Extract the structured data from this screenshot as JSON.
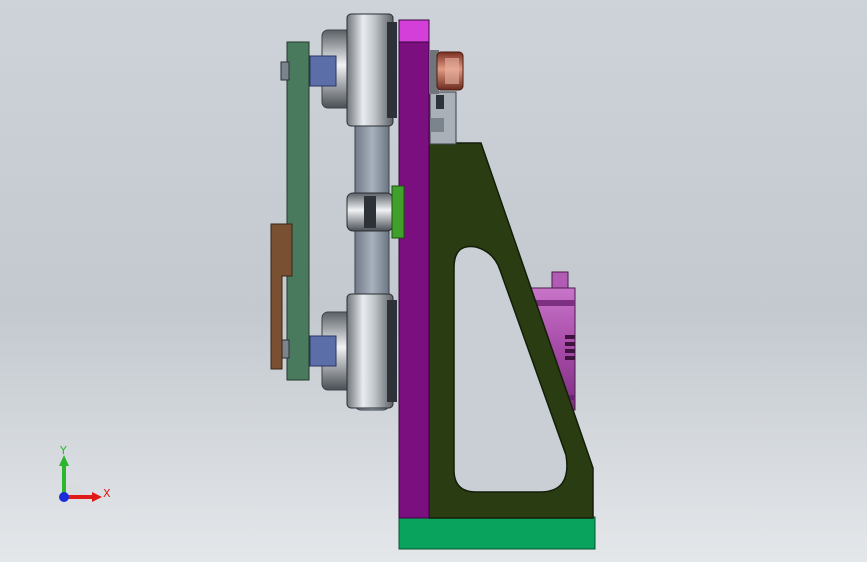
{
  "window": {
    "title": ""
  },
  "triad": {
    "x_label": "X",
    "y_label": "Y",
    "x_color": "#e01919",
    "y_color": "#2db52d",
    "z_color": "#1a2bd8"
  },
  "colors": {
    "background_top": "#cdd3d9",
    "background_bottom": "#e4e7ea",
    "base_plate": "#0aa35d",
    "mount_plate": "#7b0f80",
    "mount_plate_top": "#d43ed9",
    "bracket": "#2a3d12",
    "motor": "#a64aa8",
    "belt": "#8c98a6",
    "arm": "#4a7a5e",
    "clamp": "#7a5032",
    "idler_green": "#3fa02a",
    "copper": "#b5523c",
    "pulley": "#b7bcc2",
    "block": "#5b6ea8"
  }
}
